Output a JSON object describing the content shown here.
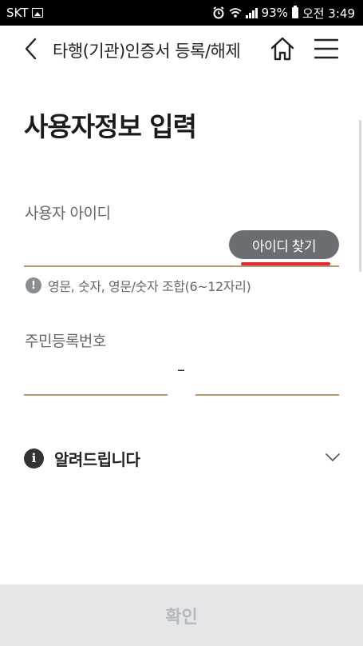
{
  "status_bar": {
    "carrier": "SKT",
    "battery": "93%",
    "time": "오전 3:49"
  },
  "header": {
    "title": "타행(기관)인증서 등록/해제",
    "back_icon": "chevron-left-icon",
    "home_icon": "home-icon",
    "menu_icon": "menu-icon"
  },
  "page": {
    "title": "사용자정보 입력"
  },
  "user_id": {
    "label": "사용자 아이디",
    "value": "",
    "find_button_label": "아이디 찾기",
    "hint": "영문, 숫자, 영문/숫자 조합(6~12자리)"
  },
  "rrn": {
    "label": "주민등록번호",
    "separator": "–",
    "front_value": "",
    "back_value": ""
  },
  "notice": {
    "label": "알려드립니다",
    "icon_char": "i"
  },
  "footer": {
    "confirm_label": "확인"
  },
  "colors": {
    "underline": "#b39b74",
    "find_button": "#6a6d72",
    "highlight": "#e8242c",
    "confirm_bg": "#e4e6e8",
    "confirm_text": "#b6b8bb"
  }
}
